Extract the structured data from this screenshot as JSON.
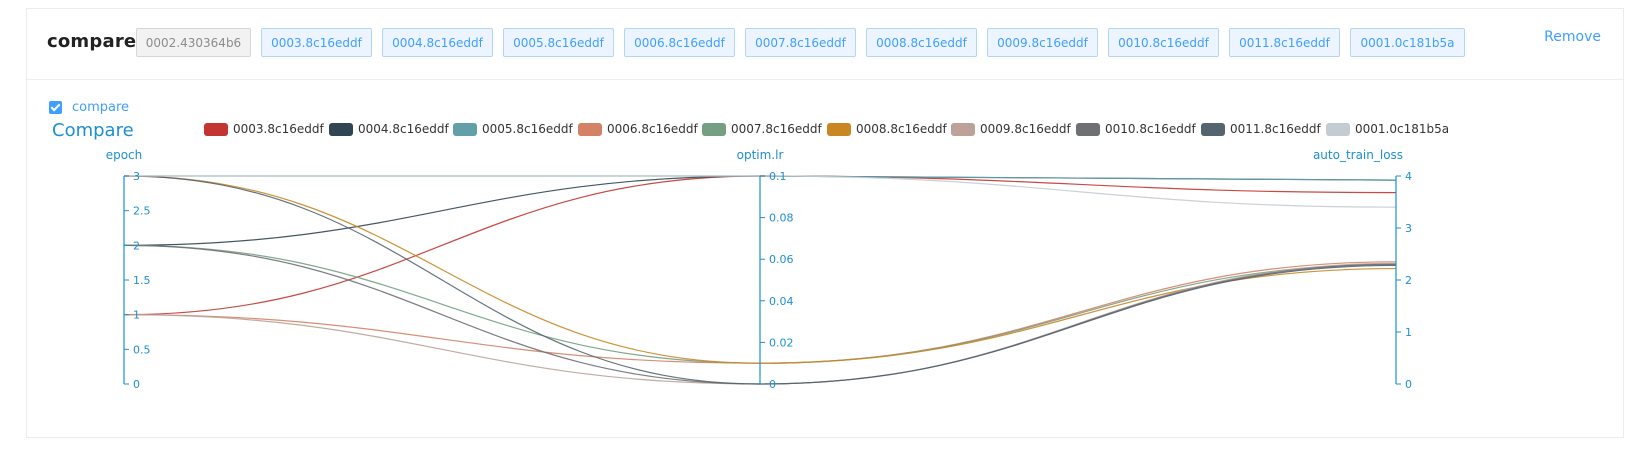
{
  "header": {
    "title": "compare",
    "base_tag": "0002.430364b6",
    "tags": [
      "0003.8c16eddf",
      "0004.8c16eddf",
      "0005.8c16eddf",
      "0006.8c16eddf",
      "0007.8c16eddf",
      "0008.8c16eddf",
      "0009.8c16eddf",
      "0010.8c16eddf",
      "0011.8c16eddf",
      "0001.0c181b5a"
    ],
    "remove_label": "Remove"
  },
  "checkbox": {
    "label": "compare",
    "checked": true
  },
  "chart_data": {
    "type": "parallel_coordinates",
    "title": "Compare",
    "axes": [
      {
        "name": "epoch",
        "ticks": [
          "0",
          "0.5",
          "1",
          "1.5",
          "2",
          "2.5",
          "3"
        ],
        "range": [
          0,
          3
        ]
      },
      {
        "name": "optim.lr",
        "ticks": [
          "0",
          "0.02",
          "0.04",
          "0.06",
          "0.08",
          "0.1"
        ],
        "range": [
          0,
          0.1
        ]
      },
      {
        "name": "auto_train_loss",
        "ticks": [
          "0",
          "1",
          "2",
          "3",
          "4"
        ],
        "range": [
          0,
          4
        ]
      }
    ],
    "series": [
      {
        "name": "0003.8c16eddf",
        "color": "#c23531",
        "values": [
          1,
          0.1,
          3.68
        ]
      },
      {
        "name": "0004.8c16eddf",
        "color": "#2f4554",
        "values": [
          2,
          0.1,
          3.92
        ]
      },
      {
        "name": "0005.8c16eddf",
        "color": "#61a0a8",
        "values": [
          3,
          0.1,
          3.92
        ]
      },
      {
        "name": "0006.8c16eddf",
        "color": "#d48265",
        "values": [
          1,
          0.01,
          2.35
        ]
      },
      {
        "name": "0007.8c16eddf",
        "color": "#749f83",
        "values": [
          2,
          0.01,
          2.3
        ]
      },
      {
        "name": "0008.8c16eddf",
        "color": "#ca8622",
        "values": [
          3,
          0.01,
          2.22
        ]
      },
      {
        "name": "0009.8c16eddf",
        "color": "#bda29a",
        "values": [
          1,
          0.0,
          2.32
        ]
      },
      {
        "name": "0010.8c16eddf",
        "color": "#6e7074",
        "values": [
          2,
          0.0,
          2.3
        ]
      },
      {
        "name": "0011.8c16eddf",
        "color": "#546570",
        "values": [
          3,
          0.0,
          2.28
        ]
      },
      {
        "name": "0001.0c181b5a",
        "color": "#c4ccd3",
        "values": [
          3,
          0.1,
          3.4
        ]
      }
    ]
  }
}
